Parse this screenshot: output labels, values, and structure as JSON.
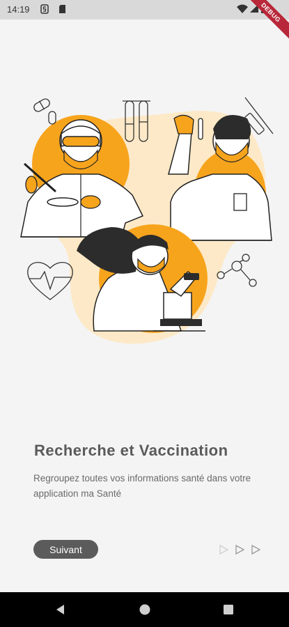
{
  "status_bar": {
    "time": "14:19",
    "debug_label": "DEBUG",
    "icons": [
      "s-icon",
      "sd-card-icon",
      "wifi-icon",
      "signal-icon",
      "battery-icon"
    ]
  },
  "onboarding": {
    "title": "Recherche et Vaccination",
    "description": "Regroupez toutes vos informations santé dans votre application ma Santé",
    "next_button_label": "Suivant",
    "page_indicators": 3,
    "accent_color": "#f7a41d"
  },
  "navigation_bar": {
    "buttons": [
      "back-icon",
      "home-icon",
      "recents-icon"
    ]
  }
}
